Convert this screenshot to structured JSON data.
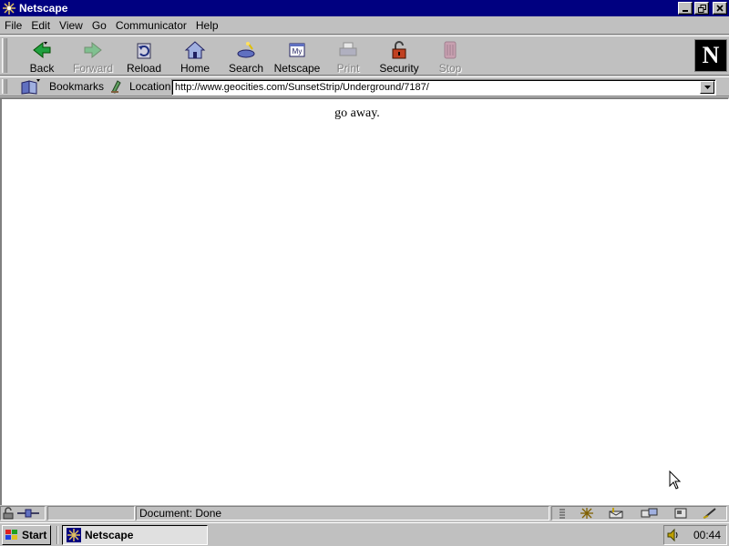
{
  "window": {
    "title": "Netscape",
    "icon": "netscape-star-icon"
  },
  "menubar": {
    "items": [
      "File",
      "Edit",
      "View",
      "Go",
      "Communicator",
      "Help"
    ]
  },
  "navbar": {
    "buttons": [
      {
        "label": "Back",
        "icon": "back-arrow-icon",
        "enabled": true
      },
      {
        "label": "Forward",
        "icon": "forward-arrow-icon",
        "enabled": false
      },
      {
        "label": "Reload",
        "icon": "reload-icon",
        "enabled": true
      },
      {
        "label": "Home",
        "icon": "home-icon",
        "enabled": true
      },
      {
        "label": "Search",
        "icon": "search-icon",
        "enabled": true
      },
      {
        "label": "Netscape",
        "icon": "my-netscape-icon",
        "enabled": true
      },
      {
        "label": "Print",
        "icon": "print-icon",
        "enabled": false
      },
      {
        "label": "Security",
        "icon": "lock-icon",
        "enabled": true
      },
      {
        "label": "Stop",
        "icon": "stop-icon",
        "enabled": false
      }
    ],
    "logo": "N"
  },
  "locationbar": {
    "bookmarks_label": "Bookmarks",
    "location_label": "Location:",
    "url": "http://www.geocities.com/SunsetStrip/Underground/7187/"
  },
  "content": {
    "text": "go away."
  },
  "statusbar": {
    "status_text": "Document: Done"
  },
  "taskbar": {
    "start_label": "Start",
    "task_label": "Netscape",
    "clock": "00:44"
  },
  "colors": {
    "titlebar": "#000080",
    "chrome": "#c0c0c0",
    "content_bg": "#ffffff"
  }
}
